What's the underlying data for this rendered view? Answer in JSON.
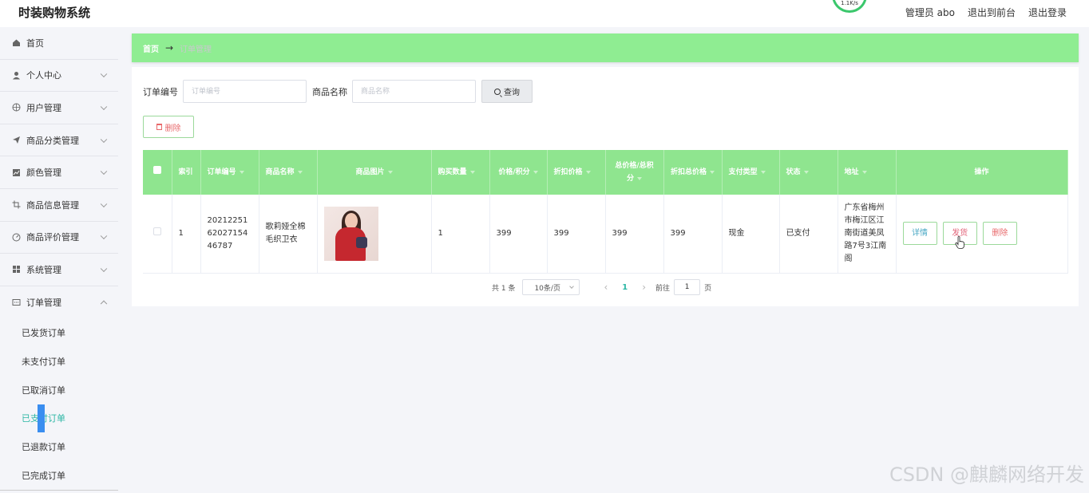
{
  "header": {
    "app_title": "时装购物系统",
    "speed": "1.1K/s",
    "admin_label": "管理员 abo",
    "to_front_label": "退出到前台",
    "logout_label": "退出登录"
  },
  "sidebar": {
    "items": [
      {
        "label": "首页",
        "icon": "home-icon",
        "chevron": false
      },
      {
        "label": "个人中心",
        "icon": "user-icon",
        "chevron": true
      },
      {
        "label": "用户管理",
        "icon": "globe-icon",
        "chevron": true
      },
      {
        "label": "商品分类管理",
        "icon": "paper-plane-icon",
        "chevron": true
      },
      {
        "label": "颜色管理",
        "icon": "chart-icon",
        "chevron": true
      },
      {
        "label": "商品信息管理",
        "icon": "crop-icon",
        "chevron": true
      },
      {
        "label": "商品评价管理",
        "icon": "gauge-icon",
        "chevron": true
      },
      {
        "label": "系统管理",
        "icon": "grid-icon",
        "chevron": true
      },
      {
        "label": "订单管理",
        "icon": "chat-icon",
        "chevron": true,
        "expanded": true
      }
    ],
    "submenu": [
      {
        "label": "已发货订单"
      },
      {
        "label": "未支付订单"
      },
      {
        "label": "已取消订单"
      },
      {
        "label": "已支付订单",
        "active": true
      },
      {
        "label": "已退款订单"
      },
      {
        "label": "已完成订单"
      }
    ]
  },
  "breadcrumb": {
    "home": "首页",
    "arrow": "→",
    "current": "订单管理"
  },
  "search": {
    "order_no_label": "订单编号",
    "order_no_placeholder": "订单编号",
    "product_name_label": "商品名称",
    "product_name_placeholder": "商品名称",
    "query_label": "查询"
  },
  "toolbar": {
    "delete_label": "删除"
  },
  "table": {
    "columns": [
      "索引",
      "订单编号",
      "商品名称",
      "商品图片",
      "购买数量",
      "价格/积分",
      "折扣价格",
      "总价格/总积分",
      "折扣总价格",
      "支付类型",
      "状态",
      "地址",
      "操作"
    ],
    "rows": [
      {
        "index": "1",
        "order_no": "202122516202715446787",
        "product_name": "歌莉娅全棉毛织卫衣",
        "quantity": "1",
        "price": "399",
        "discount_price": "399",
        "total_price": "399",
        "discount_total": "399",
        "pay_type": "现金",
        "status": "已支付",
        "address": "广东省梅州市梅江区江南街道美凤路7号3江南阁",
        "actions": {
          "detail": "详情",
          "ship": "发货",
          "delete": "删除"
        }
      }
    ]
  },
  "pagination": {
    "total": "共 1 条",
    "page_size": "10条/页",
    "current_page": "1",
    "goto_label": "前往",
    "goto_value": "1",
    "page_suffix": "页"
  },
  "watermark": "CSDN @麒麟网络开发",
  "colors": {
    "accent_green": "#8fed92",
    "active_teal": "#2db7a5",
    "danger": "#e8696b"
  }
}
